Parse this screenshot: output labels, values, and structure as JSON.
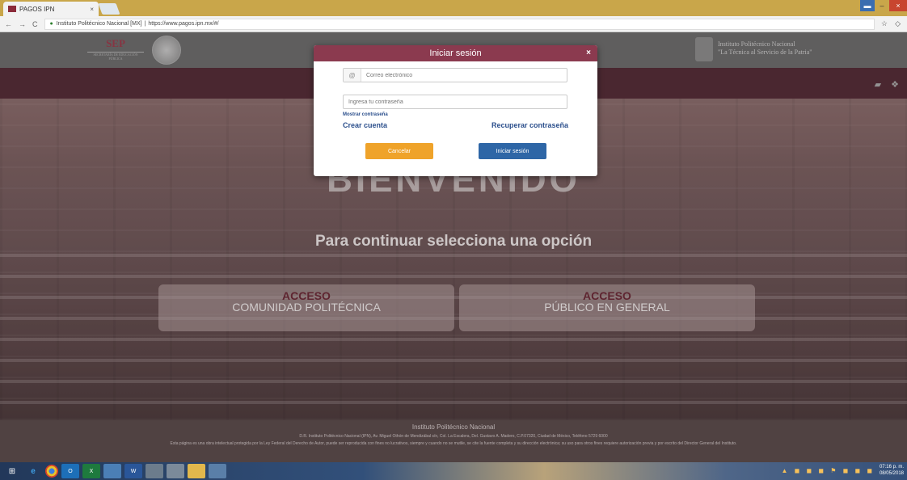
{
  "browser": {
    "tab_title": "PAGOS IPN",
    "tab_close": "×",
    "nav_back": "←",
    "nav_forward": "→",
    "nav_reload": "C",
    "url_site": "Instituto Politécnico Nacional [MX]",
    "url_separator": "|",
    "url": "https://www.pagos.ipn.mx/#/",
    "window_min": "▬",
    "window_max": "–",
    "window_close": "×",
    "bookmark_icon": "☆",
    "extension_icon": "◇"
  },
  "header": {
    "sep_logo": "SEP",
    "sep_sub": "SECRETARÍA DE EDUCACIÓN PÚBLICA",
    "ipn_line1": "Instituto Politécnico Nacional",
    "ipn_line2": "\"La Técnica al Servicio de la Patria\""
  },
  "navbar": {
    "icon1": "▰",
    "icon2": "❖"
  },
  "hero": {
    "welcome": "BIENVENIDO",
    "subtitle": "Para continuar selecciona una opción",
    "card1_title": "ACCESO",
    "card1_sub": "COMUNIDAD POLITÉCNICA",
    "card2_title": "ACCESO",
    "card2_sub": "PÚBLICO EN GENERAL"
  },
  "footer": {
    "line1": "Instituto Politécnico Nacional",
    "line2": "D.R. Instituto Politécnico Nacional (IPN), Av. Miguel Othón de Mendizábal s/n, Col. La Escalera, Del. Gustavo A. Madero, C.P.07320, Ciudad de México, Teléfono 5729 6000",
    "line3": "Esta página es una obra intelectual protegida por la Ley Federal del Derecho de Autor, puede ser reproducida con fines no lucrativos, siempre y cuando no se mutile, se cite la fuente completa y su dirección electrónica; su uso para otros fines requiere autorización previa y por escrito del Director General del Instituto."
  },
  "modal": {
    "title": "Iniciar sesión",
    "close": "×",
    "email_icon": "@",
    "email_placeholder": "Correo electrónico",
    "password_placeholder": "Ingresa tu contraseña",
    "show_password": "Mostrar contraseña",
    "create_account": "Crear cuenta",
    "recover_password": "Recuperar contraseña",
    "cancel": "Cancelar",
    "login": "Iniciar sesión"
  },
  "taskbar": {
    "time": "07:16 p. m.",
    "date": "08/05/2018",
    "tray_icons": "▲ ◼ ◼ ◼ ⚑ ◼ ◼ ◼"
  },
  "colors": {
    "modal_header": "#8b3a4f",
    "cancel_button": "#efa32a",
    "login_button": "#2e66a6",
    "link": "#2b4f8c",
    "navbar": "#532b35"
  }
}
